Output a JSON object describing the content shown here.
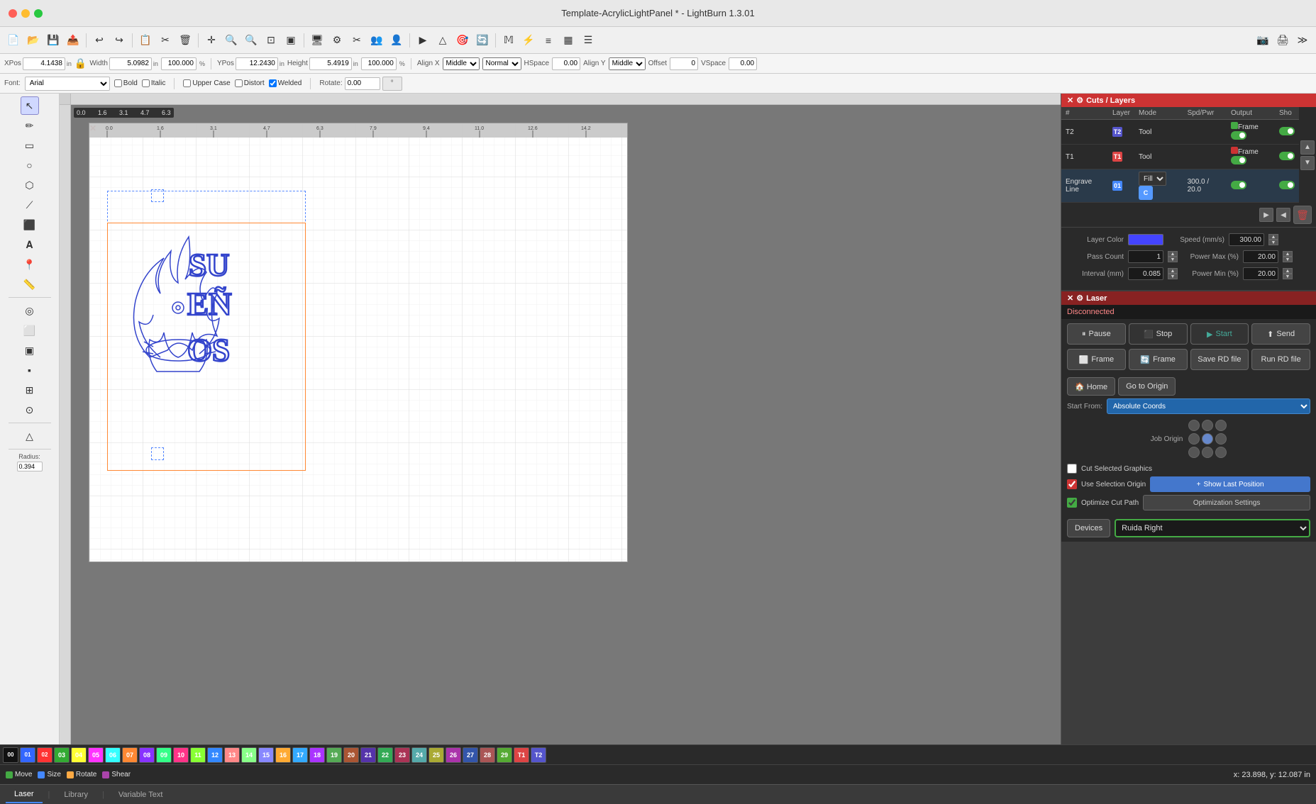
{
  "titlebar": {
    "title": "Template-AcrylicLightPanel * - LightBurn 1.3.01",
    "close": "×",
    "min": "−",
    "max": "+"
  },
  "toolbar": {
    "tools": [
      "📁",
      "💾",
      "🖨",
      "↩",
      "↪",
      "📋",
      "✂",
      "🗑",
      "✛",
      "🔍",
      "🔍",
      "🔍",
      "⬜",
      "🖥",
      "⚙",
      "✂",
      "👥",
      "👤",
      "▶",
      "△",
      "🎯",
      "🔄",
      "𝕄",
      "⚡",
      "≡",
      "▦",
      "☰",
      "✕",
      "≫"
    ]
  },
  "properties": {
    "xpos_label": "XPos",
    "xpos_value": "4.1438",
    "ypos_label": "YPos",
    "ypos_value": "12.2430",
    "width_label": "Width",
    "width_value": "5.0982",
    "height_label": "Height",
    "height_value": "5.4919",
    "unit": "in",
    "percent": "%",
    "w_num": "100.000",
    "h_num": "100.000",
    "align_x_label": "Align X",
    "align_x_value": "Middle",
    "align_y_label": "Align Y",
    "align_y_value": "Middle",
    "hspace_label": "HSpace",
    "hspace_value": "0.00",
    "vspace_label": "VSpace",
    "vspace_value": "0.00",
    "offset_label": "Offset",
    "offset_value": "0",
    "normal_value": "Normal"
  },
  "fontbar": {
    "font_label": "Font:",
    "font_value": "Arial",
    "bold_label": "Bold",
    "italic_label": "Italic",
    "upper_case_label": "Upper Case",
    "distort_label": "Distort",
    "welded_label": "Welded",
    "rotate_label": "Rotate:",
    "rotate_value": "0.00",
    "deg_symbol": "°"
  },
  "cuts_layers": {
    "title": "Cuts / Layers",
    "col_hash": "#",
    "col_layer": "Layer",
    "col_mode": "Mode",
    "col_spd_pwr": "Spd/Pwr",
    "col_output": "Output",
    "col_show": "Sho",
    "rows": [
      {
        "id": "T2",
        "color": "T2",
        "color_class": "layer-t2",
        "mode": "Tool",
        "indicator": "Frame",
        "output": "on",
        "show": "on"
      },
      {
        "id": "T1",
        "color": "T1",
        "color_class": "layer-t1",
        "mode": "Tool",
        "indicator": "Frame",
        "output": "on",
        "show": "on"
      },
      {
        "id": "Engrave Line",
        "color": "01",
        "color_class": "layer-01",
        "mode": "Fill",
        "spd_pwr": "300.0 / 20.0",
        "output": "on",
        "show": "on"
      }
    ],
    "layer_color_label": "Layer Color",
    "speed_label": "Speed (mm/s)",
    "speed_value": "300.00",
    "pass_count_label": "Pass Count",
    "pass_count_value": "1",
    "power_max_label": "Power Max (%)",
    "power_max_value": "20.00",
    "interval_label": "Interval (mm)",
    "interval_value": "0.085",
    "power_min_label": "Power Min (%)",
    "power_min_value": "20.00"
  },
  "laser_panel": {
    "title": "Laser",
    "disconnected": "Disconnected",
    "pause_btn": "Pause",
    "stop_btn": "Stop",
    "start_btn": "Start",
    "send_btn": "Send",
    "frame_btn1": "Frame",
    "frame_btn2": "Frame",
    "save_rd_btn": "Save RD file",
    "run_rd_btn": "Run RD file",
    "home_btn": "Home",
    "go_to_origin_btn": "Go to Origin",
    "start_from_label": "Start From:",
    "start_from_value": "Absolute Coords",
    "job_origin_label": "Job Origin",
    "cut_selected_label": "Cut Selected Graphics",
    "use_selection_origin_label": "Use Selection Origin",
    "optimize_cut_path_label": "Optimize Cut Path",
    "show_last_position_btn": "+ Show Last Position",
    "optimization_settings_btn": "Optimization Settings",
    "devices_label": "Devices",
    "devices_value": "Ruida Right"
  },
  "bottom_tabs": {
    "laser_tab": "Laser",
    "library_tab": "Library",
    "sep": "|",
    "variable_text_tab": "Variable Text"
  },
  "statusbar": {
    "move_label": "Move",
    "size_label": "Size",
    "rotate_label": "Rotate",
    "shear_label": "Shear",
    "coords": "x: 23.898, y: 12.087 in"
  },
  "palette": {
    "colors": [
      {
        "label": "00",
        "bg": "#111111"
      },
      {
        "label": "01",
        "bg": "#3366ff"
      },
      {
        "label": "02",
        "bg": "#ff3333"
      },
      {
        "label": "03",
        "bg": "#33aa33"
      },
      {
        "label": "04",
        "bg": "#ffff33"
      },
      {
        "label": "05",
        "bg": "#ff33ff"
      },
      {
        "label": "06",
        "bg": "#33ffff"
      },
      {
        "label": "07",
        "bg": "#ff8833"
      },
      {
        "label": "08",
        "bg": "#8833ff"
      },
      {
        "label": "09",
        "bg": "#33ff88"
      },
      {
        "label": "10",
        "bg": "#ff3388"
      },
      {
        "label": "11",
        "bg": "#88ff33"
      },
      {
        "label": "12",
        "bg": "#3388ff"
      },
      {
        "label": "13",
        "bg": "#ff8888"
      },
      {
        "label": "14",
        "bg": "#88ff88"
      },
      {
        "label": "15",
        "bg": "#8888ff"
      },
      {
        "label": "16",
        "bg": "#ffaa33"
      },
      {
        "label": "17",
        "bg": "#33aaff"
      },
      {
        "label": "18",
        "bg": "#aa33ff"
      },
      {
        "label": "19",
        "bg": "#55aa55"
      },
      {
        "label": "20",
        "bg": "#aa5533"
      },
      {
        "label": "21",
        "bg": "#5533aa"
      },
      {
        "label": "22",
        "bg": "#33aa55"
      },
      {
        "label": "23",
        "bg": "#aa3355"
      },
      {
        "label": "24",
        "bg": "#55aaaa"
      },
      {
        "label": "25",
        "bg": "#aaaa33"
      },
      {
        "label": "26",
        "bg": "#aa33aa"
      },
      {
        "label": "27",
        "bg": "#3355aa"
      },
      {
        "label": "28",
        "bg": "#aa5555"
      },
      {
        "label": "29",
        "bg": "#55aa33"
      },
      {
        "label": "T1",
        "bg": "#dd4444"
      },
      {
        "label": "T2",
        "bg": "#5555cc"
      }
    ]
  },
  "canvas": {
    "cursor_cross": "✕"
  }
}
